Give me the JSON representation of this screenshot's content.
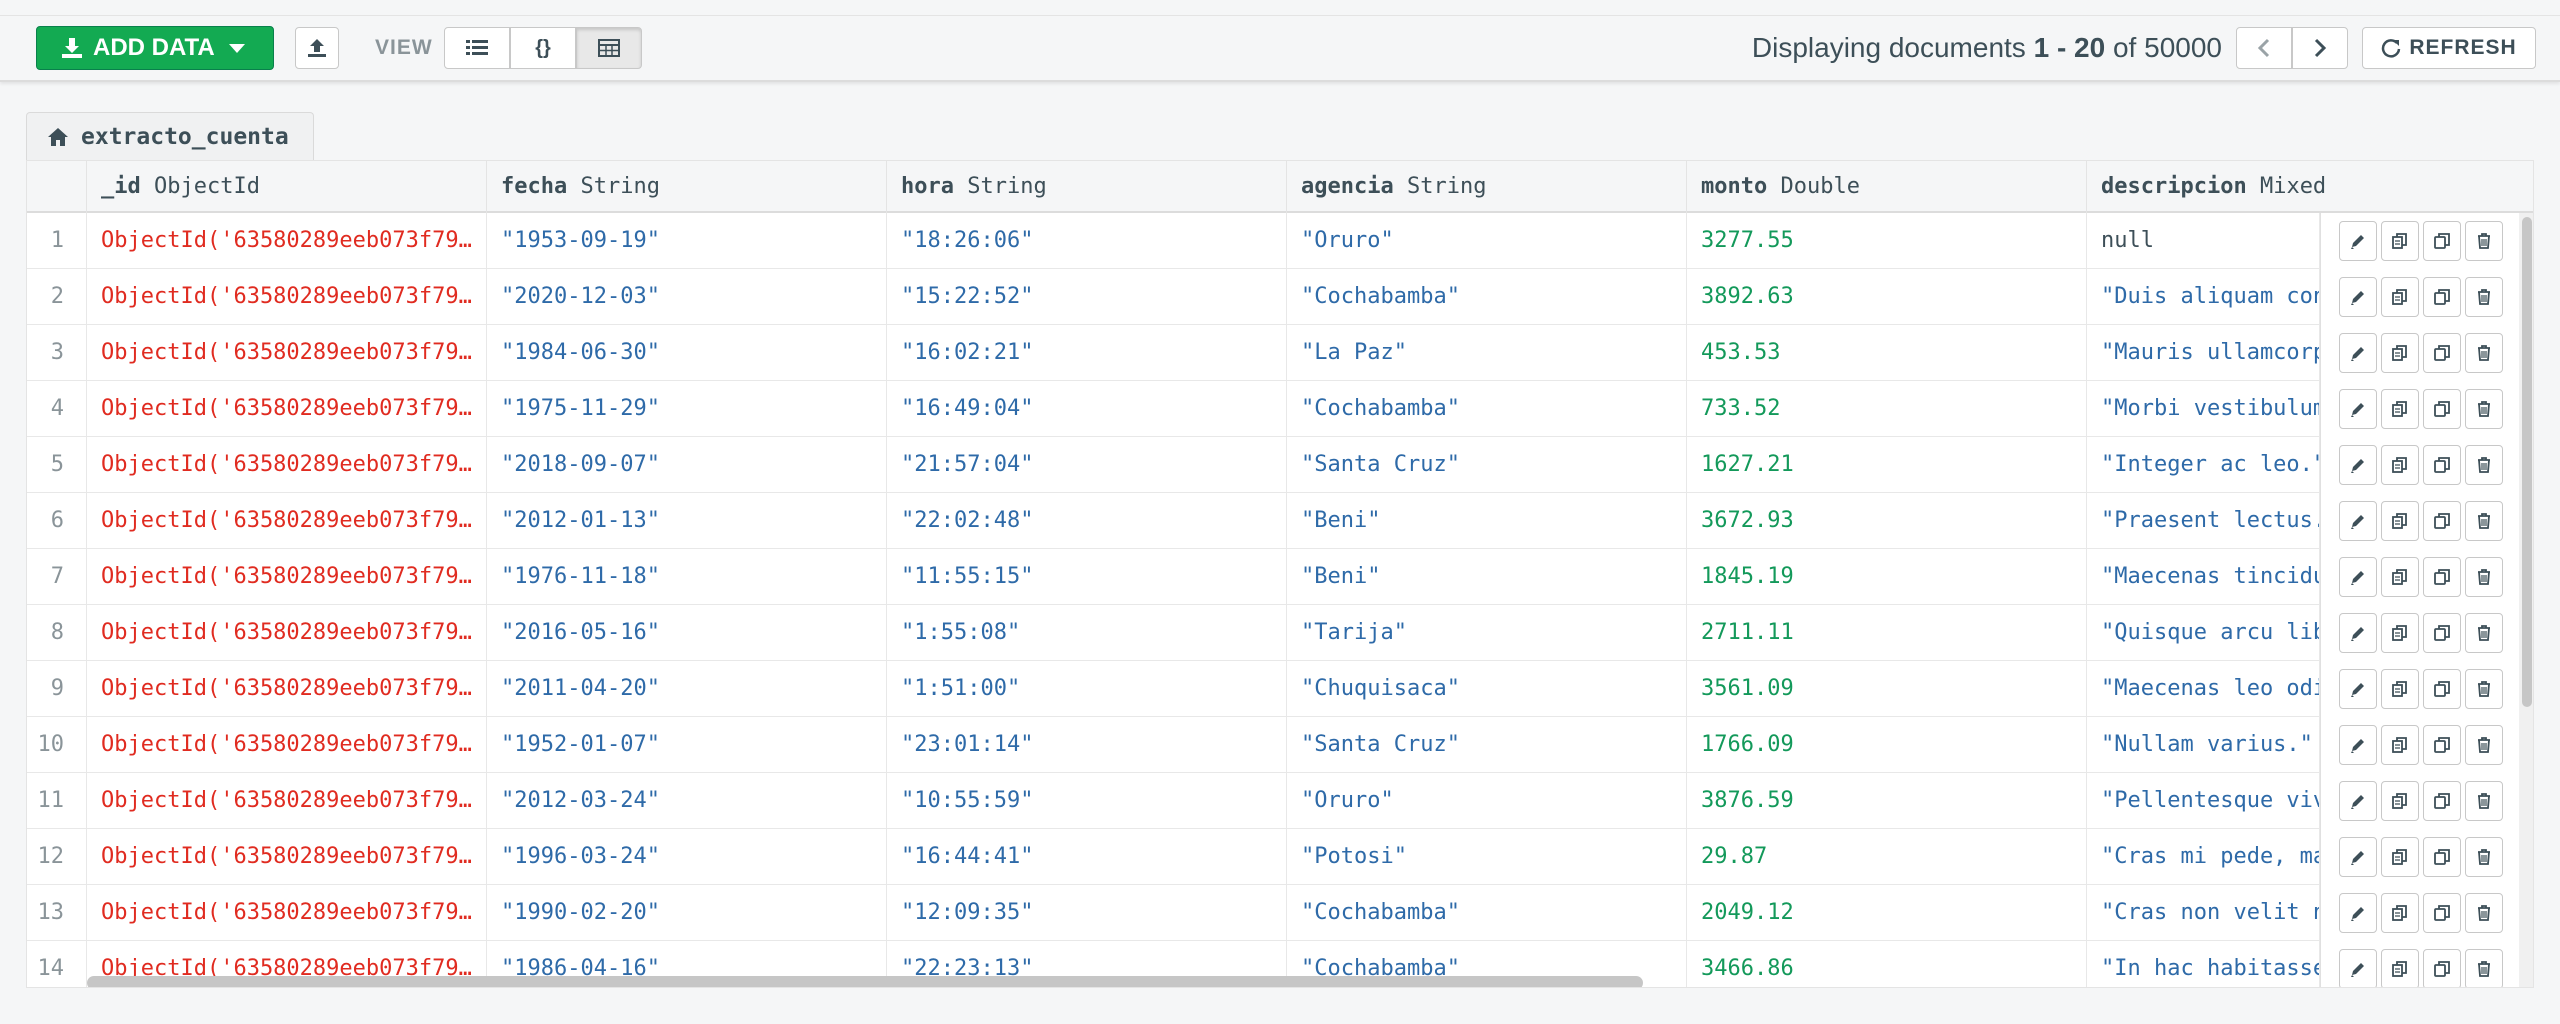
{
  "toolbar": {
    "add_data_label": "ADD DATA",
    "view_label": "VIEW",
    "view_list_label": "{}",
    "pager_prefix": "Displaying documents",
    "pager_range": "1 - 20",
    "pager_of": "of",
    "pager_total": "50000",
    "refresh_label": "REFRESH"
  },
  "collection_tab": {
    "label": "extracto_cuenta"
  },
  "columns": [
    {
      "name": "_id",
      "type": "ObjectId"
    },
    {
      "name": "fecha",
      "type": "String"
    },
    {
      "name": "hora",
      "type": "String"
    },
    {
      "name": "agencia",
      "type": "String"
    },
    {
      "name": "monto",
      "type": "Double"
    },
    {
      "name": "descripcion",
      "type": "Mixed"
    }
  ],
  "rows": [
    {
      "n": "1",
      "id": "ObjectId('63580289eeb073f79…",
      "fecha": "\"1953-09-19\"",
      "hora": "\"18:26:06\"",
      "agencia": "\"Oruro\"",
      "monto": "3277.55",
      "descripcion": "null"
    },
    {
      "n": "2",
      "id": "ObjectId('63580289eeb073f79…",
      "fecha": "\"2020-12-03\"",
      "hora": "\"15:22:52\"",
      "agencia": "\"Cochabamba\"",
      "monto": "3892.63",
      "descripcion": "\"Duis aliquam convallis\""
    },
    {
      "n": "3",
      "id": "ObjectId('63580289eeb073f79…",
      "fecha": "\"1984-06-30\"",
      "hora": "\"16:02:21\"",
      "agencia": "\"La Paz\"",
      "monto": "453.53",
      "descripcion": "\"Mauris ullamcorper\""
    },
    {
      "n": "4",
      "id": "ObjectId('63580289eeb073f79…",
      "fecha": "\"1975-11-29\"",
      "hora": "\"16:49:04\"",
      "agencia": "\"Cochabamba\"",
      "monto": "733.52",
      "descripcion": "\"Morbi vestibulum\""
    },
    {
      "n": "5",
      "id": "ObjectId('63580289eeb073f79…",
      "fecha": "\"2018-09-07\"",
      "hora": "\"21:57:04\"",
      "agencia": "\"Santa Cruz\"",
      "monto": "1627.21",
      "descripcion": "\"Integer ac leo.\""
    },
    {
      "n": "6",
      "id": "ObjectId('63580289eeb073f79…",
      "fecha": "\"2012-01-13\"",
      "hora": "\"22:02:48\"",
      "agencia": "\"Beni\"",
      "monto": "3672.93",
      "descripcion": "\"Praesent lectus.\""
    },
    {
      "n": "7",
      "id": "ObjectId('63580289eeb073f79…",
      "fecha": "\"1976-11-18\"",
      "hora": "\"11:55:15\"",
      "agencia": "\"Beni\"",
      "monto": "1845.19",
      "descripcion": "\"Maecenas tincidunt\""
    },
    {
      "n": "8",
      "id": "ObjectId('63580289eeb073f79…",
      "fecha": "\"2016-05-16\"",
      "hora": "\"1:55:08\"",
      "agencia": "\"Tarija\"",
      "monto": "2711.11",
      "descripcion": "\"Quisque arcu libero\""
    },
    {
      "n": "9",
      "id": "ObjectId('63580289eeb073f79…",
      "fecha": "\"2011-04-20\"",
      "hora": "\"1:51:00\"",
      "agencia": "\"Chuquisaca\"",
      "monto": "3561.09",
      "descripcion": "\"Maecenas leo odio\""
    },
    {
      "n": "10",
      "id": "ObjectId('63580289eeb073f79…",
      "fecha": "\"1952-01-07\"",
      "hora": "\"23:01:14\"",
      "agencia": "\"Santa Cruz\"",
      "monto": "1766.09",
      "descripcion": "\"Nullam varius.\""
    },
    {
      "n": "11",
      "id": "ObjectId('63580289eeb073f79…",
      "fecha": "\"2012-03-24\"",
      "hora": "\"10:55:59\"",
      "agencia": "\"Oruro\"",
      "monto": "3876.59",
      "descripcion": "\"Pellentesque viverra\""
    },
    {
      "n": "12",
      "id": "ObjectId('63580289eeb073f79…",
      "fecha": "\"1996-03-24\"",
      "hora": "\"16:44:41\"",
      "agencia": "\"Potosi\"",
      "monto": "29.87",
      "descripcion": "\"Cras mi pede, malesuada\""
    },
    {
      "n": "13",
      "id": "ObjectId('63580289eeb073f79…",
      "fecha": "\"1990-02-20\"",
      "hora": "\"12:09:35\"",
      "agencia": "\"Cochabamba\"",
      "monto": "2049.12",
      "descripcion": "\"Cras non velit nec\""
    },
    {
      "n": "14",
      "id": "ObjectId('63580289eeb073f79…",
      "fecha": "\"1986-04-16\"",
      "hora": "\"22:23:13\"",
      "agencia": "\"Cochabamba\"",
      "monto": "3466.86",
      "descripcion": "\"In hac habitasse\""
    }
  ],
  "row_actions": [
    "pencil-icon",
    "copy-icon",
    "clone-icon",
    "trash-icon"
  ],
  "colors": {
    "accent": "#13aa52",
    "objectid": "#e02b20",
    "string": "#2e6aa8",
    "number": "#13995a"
  }
}
